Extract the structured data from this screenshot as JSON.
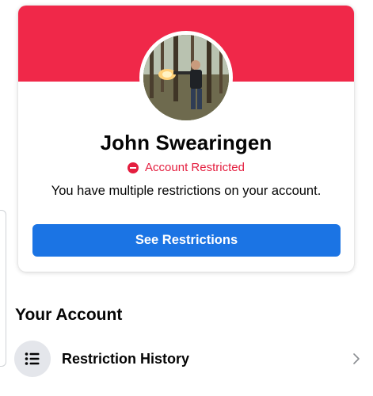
{
  "profile": {
    "name": "John Swearingen",
    "status": "Account Restricted",
    "description": "You have multiple restrictions on your account.",
    "cta_label": "See Restrictions"
  },
  "account_section": {
    "title": "Your Account",
    "items": [
      {
        "label": "Restriction History",
        "icon": "list-icon"
      }
    ]
  },
  "colors": {
    "banner": "#f02849",
    "restricted_red": "#e41e3f",
    "button_blue": "#1b74e4",
    "icon_bg": "#e4e6eb"
  },
  "icons": {
    "status": "minus-circle-icon",
    "row": "list-icon",
    "row_trailing": "chevron-right-icon"
  }
}
